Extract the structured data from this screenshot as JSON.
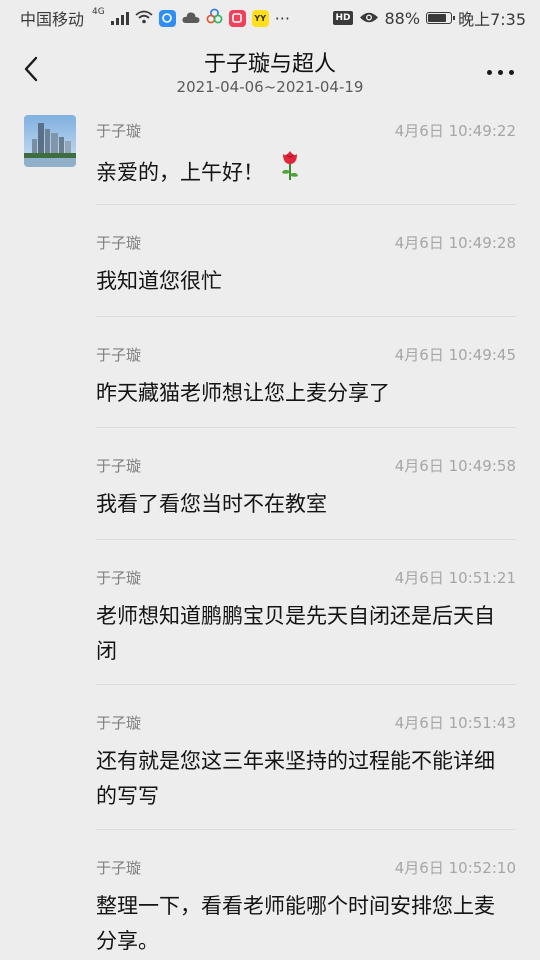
{
  "status_bar": {
    "carrier": "中国移动",
    "network_type": "4G",
    "battery": "88%",
    "battery_level": 0.88,
    "time": "晚上7:35",
    "hd_label": "HD",
    "yy_label": "YY",
    "more_indicator": "···",
    "icons": [
      "signal-icon",
      "wifi-icon",
      "app-icon-blue",
      "cloud-icon",
      "app-icon-circles",
      "app-icon-red",
      "app-icon-yy",
      "hd-icon",
      "eye-icon",
      "battery-icon"
    ]
  },
  "header": {
    "title": "于子璇与超人",
    "subtitle": "2021-04-06~2021-04-19",
    "back_icon": "chevron-left-icon",
    "more_icon": "more-dots-icon"
  },
  "messages": [
    {
      "sender": "于子璇",
      "time": "4月6日 10:49:22",
      "text": "亲爱的，上午好！",
      "emoji": "rose-icon"
    },
    {
      "sender": "于子璇",
      "time": "4月6日 10:49:28",
      "text": "我知道您很忙"
    },
    {
      "sender": "于子璇",
      "time": "4月6日 10:49:45",
      "text": "昨天藏猫老师想让您上麦分享了"
    },
    {
      "sender": "于子璇",
      "time": "4月6日 10:49:58",
      "text": "我看了看您当时不在教室"
    },
    {
      "sender": "于子璇",
      "time": "4月6日 10:51:21",
      "text": "老师想知道鹏鹏宝贝是先天自闭还是后天自闭"
    },
    {
      "sender": "于子璇",
      "time": "4月6日 10:51:43",
      "text": "还有就是您这三年来坚持的过程能不能详细的写写"
    },
    {
      "sender": "于子璇",
      "time": "4月6日 10:52:10",
      "text": "整理一下，看看老师能哪个时间安排您上麦分享。"
    }
  ]
}
